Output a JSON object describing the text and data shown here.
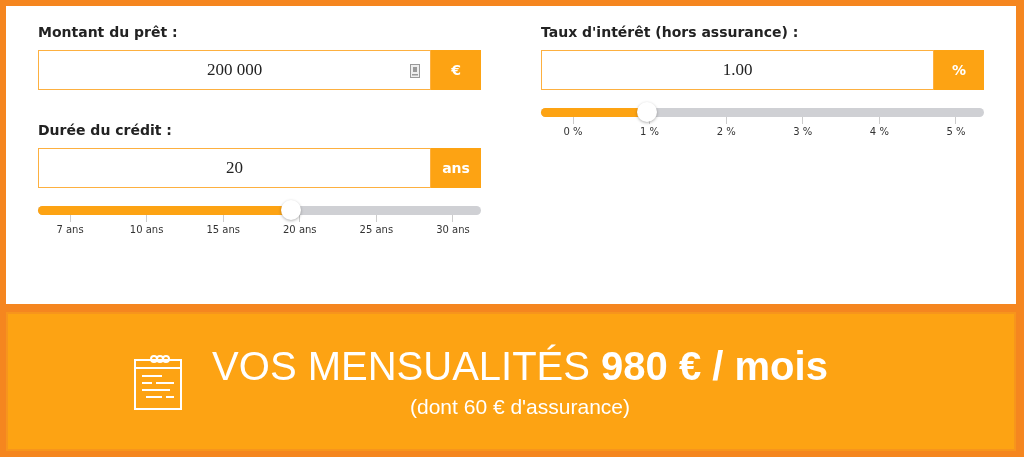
{
  "loan_amount": {
    "label": "Montant du prêt :",
    "value": "200 000",
    "unit": "€"
  },
  "duration": {
    "label": "Durée du crédit :",
    "value": "20",
    "unit": "ans",
    "slider": {
      "level": 0.57,
      "ticks": [
        "7 ans",
        "10 ans",
        "15 ans",
        "20 ans",
        "25 ans",
        "30 ans"
      ]
    }
  },
  "interest_rate": {
    "label": "Taux d'intérêt (hors assurance) :",
    "value": "1.00",
    "unit": "%",
    "slider": {
      "level": 0.24,
      "ticks": [
        "0 %",
        "1 %",
        "2 %",
        "3 %",
        "4 %",
        "5 %"
      ]
    }
  },
  "result": {
    "headline": "VOS MENSUALITÉS **980 € / mois**",
    "subline": "(dont 60 € d'assurance)"
  }
}
